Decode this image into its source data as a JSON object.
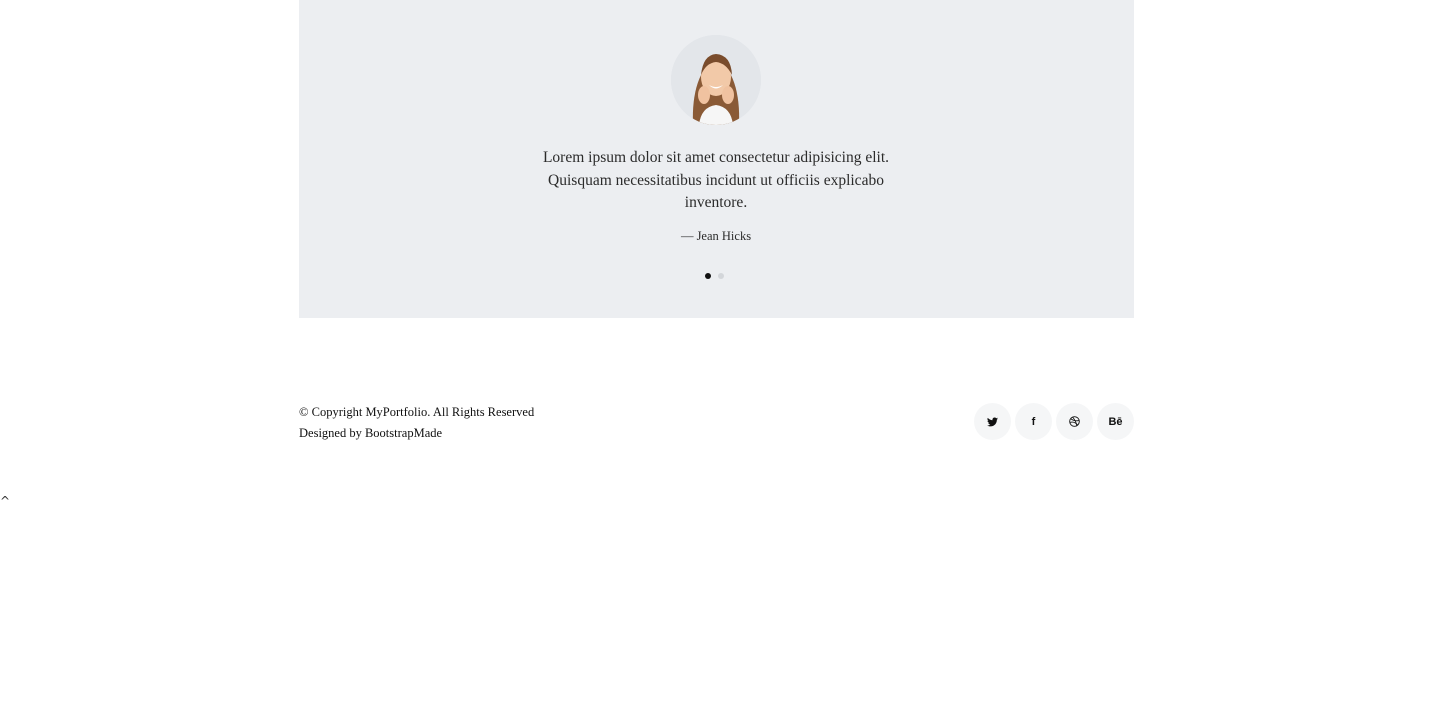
{
  "testimonial": {
    "quote": "Lorem ipsum dolor sit amet consectetur adipisicing elit. Quisquam necessitatibus incidunt ut officiis explicabo inventore.",
    "author": "— Jean Hicks",
    "active_slide": 1,
    "slide_count": 2
  },
  "footer": {
    "copyright_prefix": "© Copyright MyPortfolio. All Rights Reserved",
    "designed_by_prefix": "Designed by ",
    "designed_by_link": "BootstrapMade",
    "social": [
      {
        "icon": "twitter-icon",
        "label": ""
      },
      {
        "icon": "facebook-icon",
        "label": "f"
      },
      {
        "icon": "dribbble-icon",
        "label": ""
      },
      {
        "icon": "behance-icon",
        "label": "Bē"
      }
    ]
  },
  "back_to_top": {
    "icon": "chevron-up-icon",
    "glyph": "^"
  },
  "colors": {
    "section_bg": "#eceef1",
    "dot_active": "#111111",
    "dot_inactive": "#d3d6da"
  }
}
